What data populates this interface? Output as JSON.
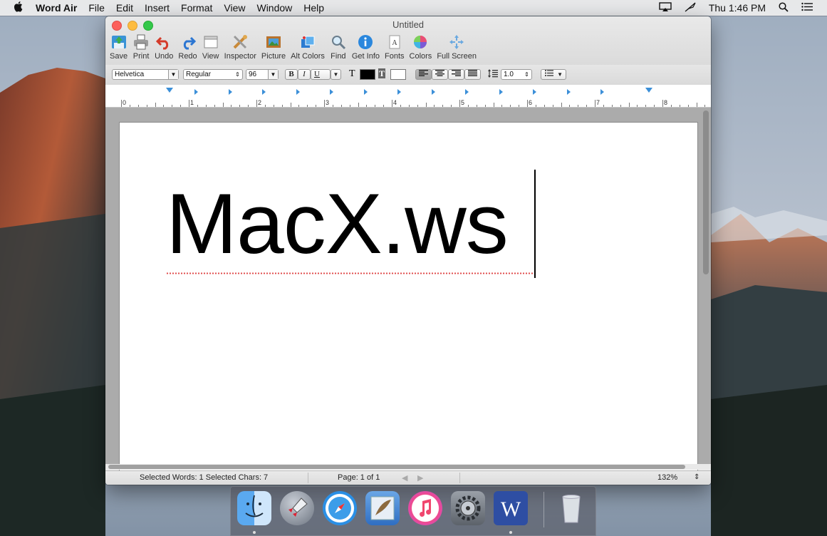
{
  "menubar": {
    "app_name": "Word Air",
    "menus": [
      "File",
      "Edit",
      "Insert",
      "Format",
      "View",
      "Window",
      "Help"
    ],
    "clock": "Thu 1:46 PM"
  },
  "window": {
    "title": "Untitled",
    "toolbar": {
      "save": "Save",
      "print": "Print",
      "undo": "Undo",
      "redo": "Redo",
      "view": "View",
      "inspector": "Inspector",
      "picture": "Picture",
      "alt_colors": "Alt Colors",
      "find": "Find",
      "get_info": "Get Info",
      "fonts": "Fonts",
      "colors": "Colors",
      "full_screen": "Full Screen"
    },
    "format": {
      "font_family": "Helvetica",
      "font_style": "Regular",
      "font_size": "96",
      "bold": "B",
      "italic": "I",
      "underline": "U",
      "text_color_glyph": "T",
      "highlight_glyph": "T",
      "line_spacing": "1.0"
    },
    "ruler": {
      "numbers": [
        "0",
        "1",
        "2",
        "3",
        "4",
        "5",
        "6",
        "7",
        "8"
      ]
    },
    "document": {
      "text": "MacX.ws"
    },
    "status": {
      "selected": "Selected Words: 1  Selected Chars: 7",
      "page": "Page: 1 of 1",
      "zoom": "132%"
    }
  },
  "colors": {
    "accent": "#3b8fd8",
    "spell_underline": "#e04b4b"
  }
}
